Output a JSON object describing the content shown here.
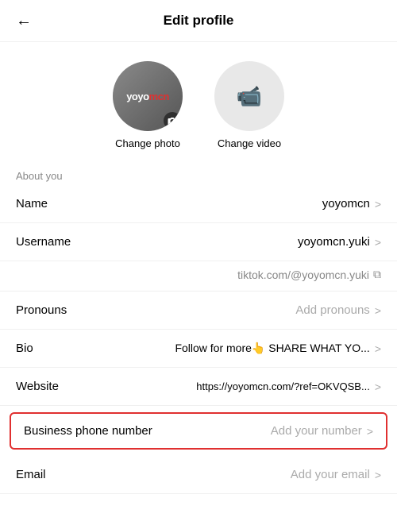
{
  "header": {
    "title": "Edit profile",
    "back_label": "←"
  },
  "media": {
    "photo": {
      "label": "Change photo",
      "logo_text": "yoyo",
      "logo_highlight": "mcn"
    },
    "video": {
      "label": "Change video"
    }
  },
  "sections": {
    "about_you": "About you"
  },
  "fields": {
    "name": {
      "label": "Name",
      "value": "yoyomcn",
      "chevron": ">"
    },
    "username": {
      "label": "Username",
      "value": "yoyomcn.yuki",
      "chevron": ">"
    },
    "url": {
      "value": "tiktok.com/@yoyomcn.yuki",
      "copy_icon": "⧉"
    },
    "pronouns": {
      "label": "Pronouns",
      "value": "Add pronouns",
      "chevron": ">"
    },
    "bio": {
      "label": "Bio",
      "emoji1": "👆",
      "value": "Follow for more👆 SHARE WHAT YO...",
      "chevron": ">"
    },
    "website": {
      "label": "Website",
      "value": "https://yoyomcn.com/?ref=OKVQSB...",
      "chevron": ">"
    },
    "business_phone": {
      "label": "Business phone number",
      "value": "Add your number",
      "chevron": ">"
    },
    "email": {
      "label": "Email",
      "value": "Add your email",
      "chevron": ">"
    }
  }
}
